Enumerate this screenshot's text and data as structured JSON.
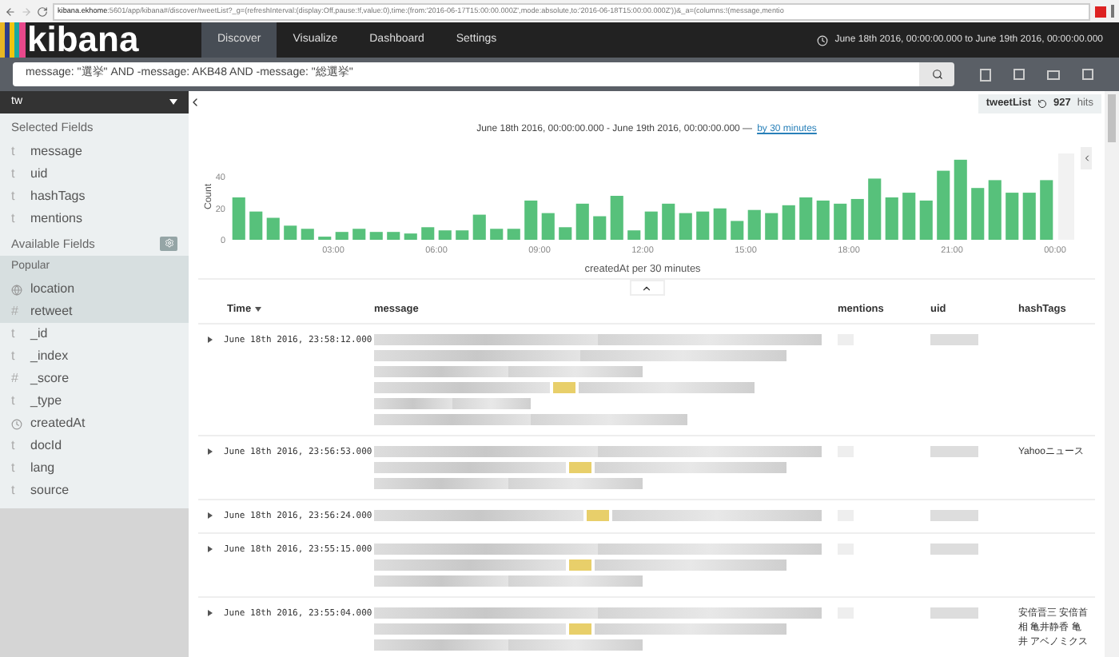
{
  "browser": {
    "url_host": "kibana.ekhome",
    "url_rest": ":5601/app/kibana#/discover/tweetList?_g=(refreshInterval:(display:Off,pause:!f,value:0),time:(from:'2016-06-17T15:00:00.000Z',mode:absolute,to:'2016-06-18T15:00:00.000Z'))&_a=(columns:!(message,mentio"
  },
  "nav": {
    "logo": "kibana",
    "tabs": [
      {
        "label": "Discover",
        "selected": true
      },
      {
        "label": "Visualize",
        "selected": false
      },
      {
        "label": "Dashboard",
        "selected": false
      },
      {
        "label": "Settings",
        "selected": false
      }
    ],
    "time_range": "June 18th 2016, 00:00:00.000 to June 19th 2016, 00:00:00.000"
  },
  "search": {
    "value": "message: \"選挙\" AND -message: AKB48 AND -message: \"総選挙\""
  },
  "sidebar": {
    "index": "tw",
    "selected_title": "Selected Fields",
    "selected_fields": [
      {
        "kind": "string",
        "type": "t",
        "name": "message"
      },
      {
        "kind": "string",
        "type": "t",
        "name": "uid"
      },
      {
        "kind": "string",
        "type": "t",
        "name": "hashTags"
      },
      {
        "kind": "string",
        "type": "t",
        "name": "mentions"
      }
    ],
    "available_title": "Available Fields",
    "popular_title": "Popular",
    "popular_fields": [
      {
        "kind": "geo",
        "name": "location"
      },
      {
        "kind": "number",
        "type": "#",
        "name": "retweet"
      }
    ],
    "other_fields": [
      {
        "kind": "string",
        "type": "t",
        "name": "_id"
      },
      {
        "kind": "string",
        "type": "t",
        "name": "_index"
      },
      {
        "kind": "number",
        "type": "#",
        "name": "_score"
      },
      {
        "kind": "string",
        "type": "t",
        "name": "_type"
      },
      {
        "kind": "date",
        "name": "createdAt"
      },
      {
        "kind": "string",
        "type": "t",
        "name": "docId"
      },
      {
        "kind": "string",
        "type": "t",
        "name": "lang"
      },
      {
        "kind": "string",
        "type": "t",
        "name": "source"
      }
    ]
  },
  "saved_search": {
    "name": "tweetList",
    "hits": "927",
    "hits_label": "hits"
  },
  "histogram": {
    "range": "June 18th 2016, 00:00:00.000 - June 19th 2016, 00:00:00.000 —",
    "interval_link": "by 30 minutes",
    "chart_data": {
      "type": "bar",
      "xlabel": "createdAt per 30 minutes",
      "ylabel": "Count",
      "x": [
        0.25,
        0.75,
        1.25,
        1.75,
        2.25,
        2.75,
        3.25,
        3.75,
        4.25,
        4.75,
        5.25,
        5.75,
        6.25,
        6.75,
        7.25,
        7.75,
        8.25,
        8.75,
        9.25,
        9.75,
        10.25,
        10.75,
        11.25,
        11.75,
        12.25,
        12.75,
        13.25,
        13.75,
        14.25,
        14.75,
        15.25,
        15.75,
        16.25,
        16.75,
        17.25,
        17.75,
        18.25,
        18.75,
        19.25,
        19.75,
        20.25,
        20.75,
        21.25,
        21.75,
        22.25,
        22.75,
        23.25,
        23.75
      ],
      "series": [
        {
          "color": "#57c17b",
          "values": [
            27,
            18,
            14,
            9,
            7,
            2,
            5,
            7,
            5,
            5,
            4,
            8,
            6,
            6,
            16,
            7,
            7,
            25,
            17,
            8,
            23,
            15,
            28,
            6,
            18,
            23,
            17,
            18,
            20,
            12,
            19,
            17,
            22,
            27,
            25,
            23,
            26,
            39,
            27,
            30,
            25,
            44,
            51,
            33,
            38,
            30,
            30,
            38
          ]
        }
      ],
      "ylim": [
        0,
        55
      ],
      "yticks": [
        0,
        20,
        40
      ],
      "xlim": [
        0,
        24
      ],
      "xticks": [
        {
          "value": 3,
          "label": "03:00"
        },
        {
          "value": 6,
          "label": "06:00"
        },
        {
          "value": 9,
          "label": "09:00"
        },
        {
          "value": 12,
          "label": "12:00"
        },
        {
          "value": 15,
          "label": "15:00"
        },
        {
          "value": 18,
          "label": "18:00"
        },
        {
          "value": 21,
          "label": "21:00"
        },
        {
          "value": 24,
          "label": "00:00"
        }
      ]
    }
  },
  "table": {
    "columns": [
      {
        "label": "Time",
        "sorted": true
      },
      {
        "label": "message",
        "sorted": false
      },
      {
        "label": "mentions",
        "sorted": false
      },
      {
        "label": "uid",
        "sorted": false
      },
      {
        "label": "hashTags",
        "sorted": false
      }
    ],
    "rows": [
      {
        "time": "June 18th 2016, 23:58:12.000",
        "kind": "tall",
        "hashTags": ""
      },
      {
        "time": "June 18th 2016, 23:56:53.000",
        "kind": "medium",
        "hashTags": "Yahooニュース"
      },
      {
        "time": "June 18th 2016, 23:56:24.000",
        "kind": "short",
        "hashTags": ""
      },
      {
        "time": "June 18th 2016, 23:55:15.000",
        "kind": "medium",
        "hashTags": ""
      },
      {
        "time": "June 18th 2016, 23:55:04.000",
        "kind": "medium",
        "hashTags": "安倍晋三 安倍首相 亀井静香 亀井 アベノミクス"
      }
    ]
  }
}
